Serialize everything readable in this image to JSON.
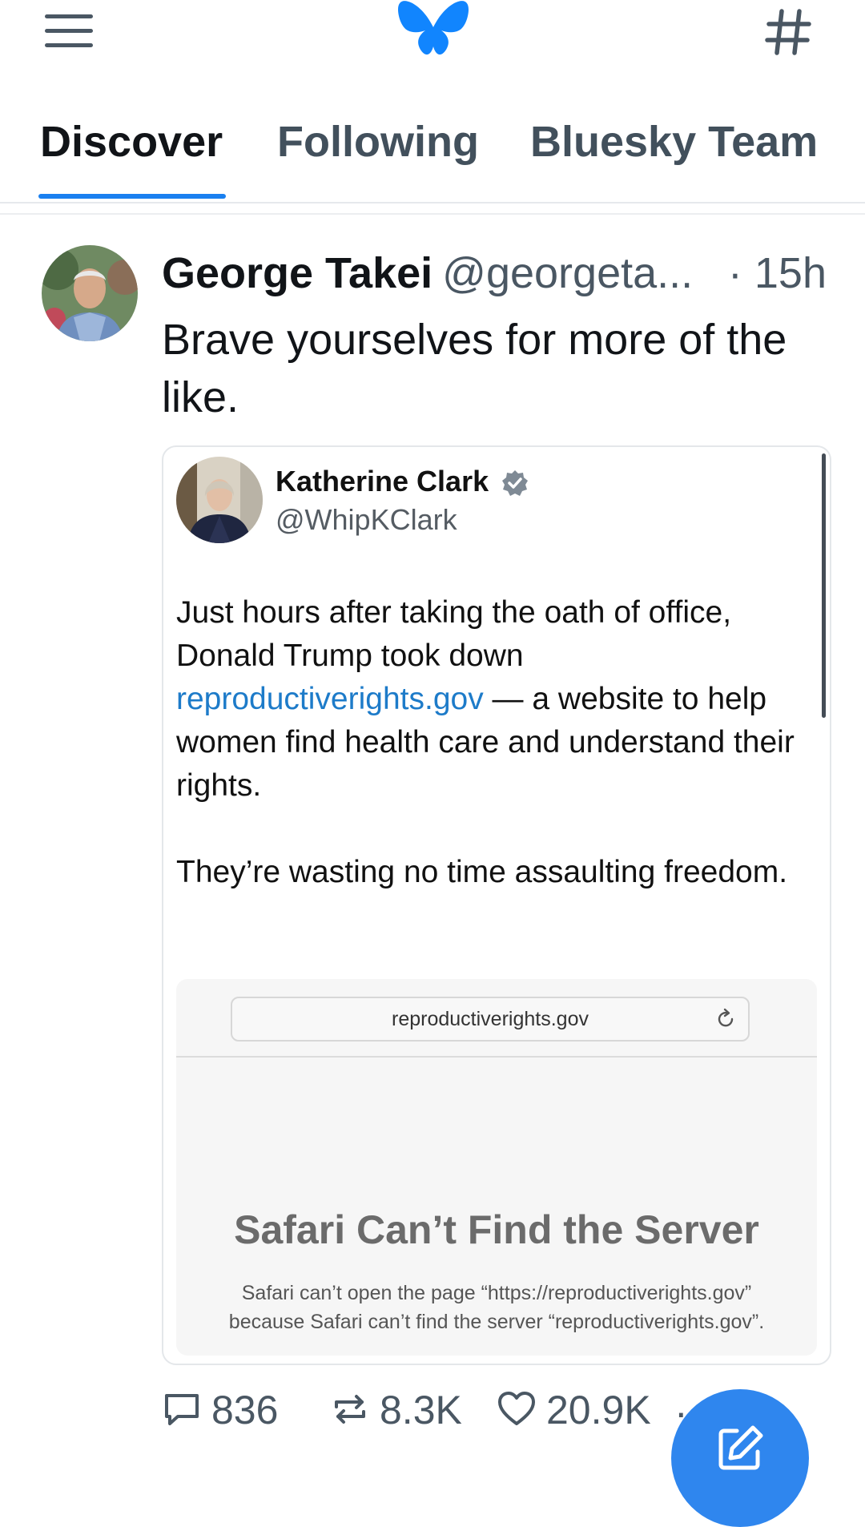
{
  "app": {
    "accent_color": "#1a80f0",
    "fab_color": "#2f86ee"
  },
  "topbar": {
    "menu_icon": "hamburger-menu-icon",
    "logo": "bluesky-butterfly-logo",
    "feeds_icon": "hashtag-icon"
  },
  "tabs": [
    {
      "label": "Discover",
      "active": true
    },
    {
      "label": "Following",
      "active": false
    },
    {
      "label": "Bluesky Team",
      "active": false
    }
  ],
  "post": {
    "author_name": "George Takei",
    "author_handle": "@georgeta...",
    "time": "· 15h",
    "text": "Brave yourselves for more of the like.",
    "embed": {
      "name": "Katherine Clark",
      "handle": "@WhipKClark",
      "para1_before": "Just hours after taking the oath of office, Donald Trump took down ",
      "para1_link": "reproductiverights.gov",
      "para1_after": " — a website to help women find health care and understand their rights.",
      "para2": "They’re wasting no time assaulting freedom.",
      "screenshot": {
        "url": "reproductiverights.gov",
        "error_title": "Safari Can’t Find the Server",
        "error_text": "Safari can’t open the page “https://reproductiverights.gov” because Safari can’t find the server “reproductiverights.gov”."
      }
    },
    "actions": {
      "replies": "836",
      "reposts": "8.3K",
      "likes": "20.9K"
    }
  }
}
